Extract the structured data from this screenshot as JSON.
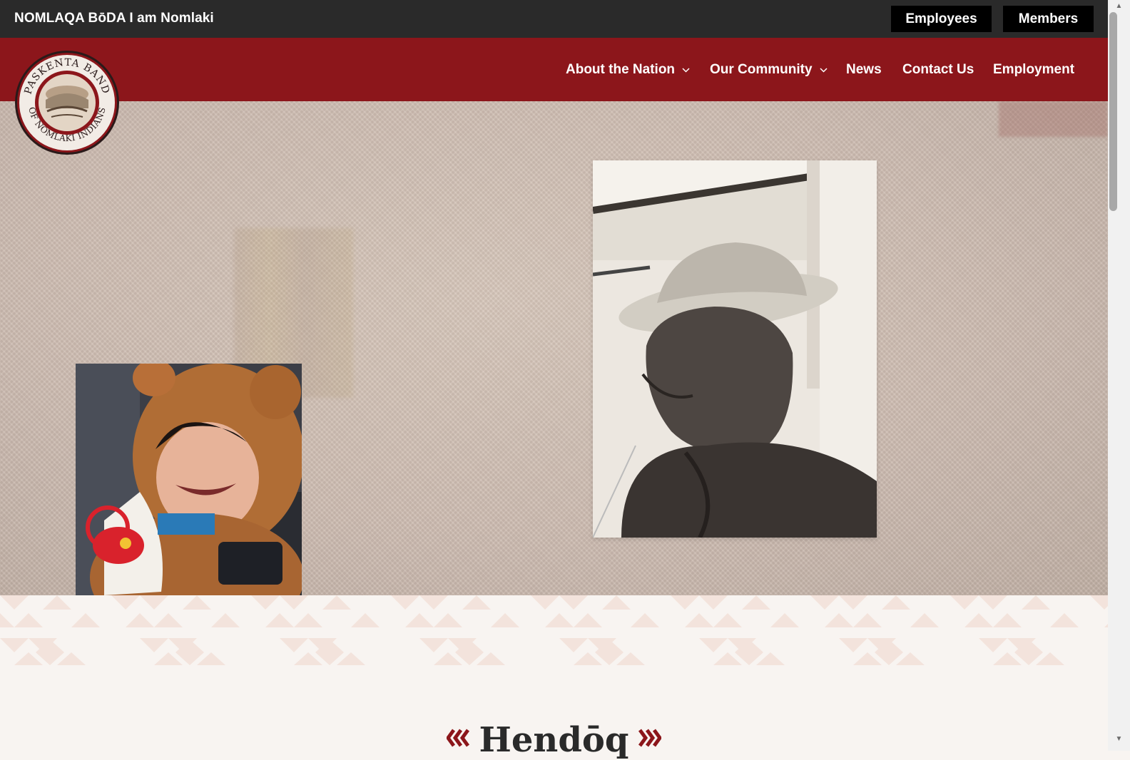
{
  "topbar": {
    "tagline": "NOMLAQA BōDA I am Nomlaki",
    "employees_label": "Employees",
    "members_label": "Members"
  },
  "logo": {
    "top_text": "PASKENTA BAND",
    "bottom_text": "OF NOMLAKI INDIANS"
  },
  "nav": {
    "items": [
      {
        "label": "About the Nation",
        "has_dropdown": true
      },
      {
        "label": "Our Community",
        "has_dropdown": true
      },
      {
        "label": "News",
        "has_dropdown": false
      },
      {
        "label": "Contact Us",
        "has_dropdown": false
      },
      {
        "label": "Employment",
        "has_dropdown": false
      }
    ]
  },
  "section": {
    "heading": "Hendōq"
  },
  "colors": {
    "brand_red": "#8c161b",
    "topbar_dark": "#2a2a2a",
    "hero_tan": "#cdbcb1",
    "pattern_pink": "#f3e3dc"
  }
}
